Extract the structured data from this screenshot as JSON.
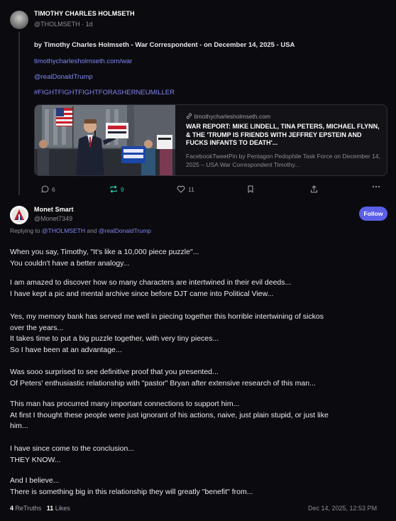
{
  "parent_post": {
    "display_name": "TIMOTHY CHARLES HOLMSETH",
    "handle": "@THOLMSETH",
    "time": "1d",
    "byline": "by Timothy Charles Holmseth - War Correspondent - on December 14, 2025 - USA",
    "link_url": "timothycharlesholmseth.com/war",
    "mention": "@realDonaldTrump",
    "hashtag": "#FIGHTFIGHTFIGHTFORASHERNEUMILLER",
    "card": {
      "domain": "timothycharlesholmseth.com",
      "title": "WAR REPORT: MIKE LINDELL, TINA PETERS, MICHAEL FLYNN, & THE 'TRUMP IS FRIENDS WITH JEFFREY EPSTEIN AND FUCKS INFANTS TO DEATH'...",
      "description": "FacebookTweetPin by Pentagon Pedophile Task Force on December 14, 2025 – USA War Correspondent Timothy..."
    },
    "actions": {
      "replies": "6",
      "retruths": "9",
      "likes": "11"
    }
  },
  "reply": {
    "display_name": "Monet Smart",
    "handle": "@Monet7349",
    "follow_label": "Follow",
    "replying_prefix": "Replying to",
    "replying_user1": "@THOLMSETH",
    "replying_and": "and",
    "replying_user2": "@realDonaldTrump",
    "paragraphs": [
      [
        "When you say, Timothy, \"It's like a 10,000 piece puzzle\"...",
        "You couldn't have a better analogy..."
      ],
      [
        "I am amazed to discover how so many characters are intertwined in their evil deeds...",
        "I have kept a pic and mental archive since before DJT came into Political View..."
      ],
      [
        "Yes, my memory bank has served me well in piecing together this horrible intertwining of sickos",
        "over the years...",
        "It takes time to put a big puzzle together, with very tiny pieces...",
        "So I have been at an advantage..."
      ],
      [
        "Was sooo surprised to see definitive proof that you presented...",
        "Of Peters' enthusiastic relationship with \"pastor\" Bryan after extensive research of this man..."
      ],
      [
        "This man has procurred many important connections to support him...",
        "At first I thought these people were just ignorant of his actions,  naive, just plain stupid, or just like",
        "him..."
      ],
      [
        "I have since come to the conclusion...",
        "THEY KNOW..."
      ],
      [
        "And I believe...",
        "There is something big in this relationship they will greatly \"benefit\" from..."
      ]
    ],
    "retruths_count": "4",
    "retruths_label": "ReTruths",
    "likes_count": "11",
    "likes_label": "Likes",
    "timestamp": "Dec 14, 2025, 12:53 PM"
  },
  "colors": {
    "background": "#0b0b0f",
    "accent": "#5b5fe8",
    "link": "#7f85f2",
    "retruth_active": "#27c7a6"
  }
}
